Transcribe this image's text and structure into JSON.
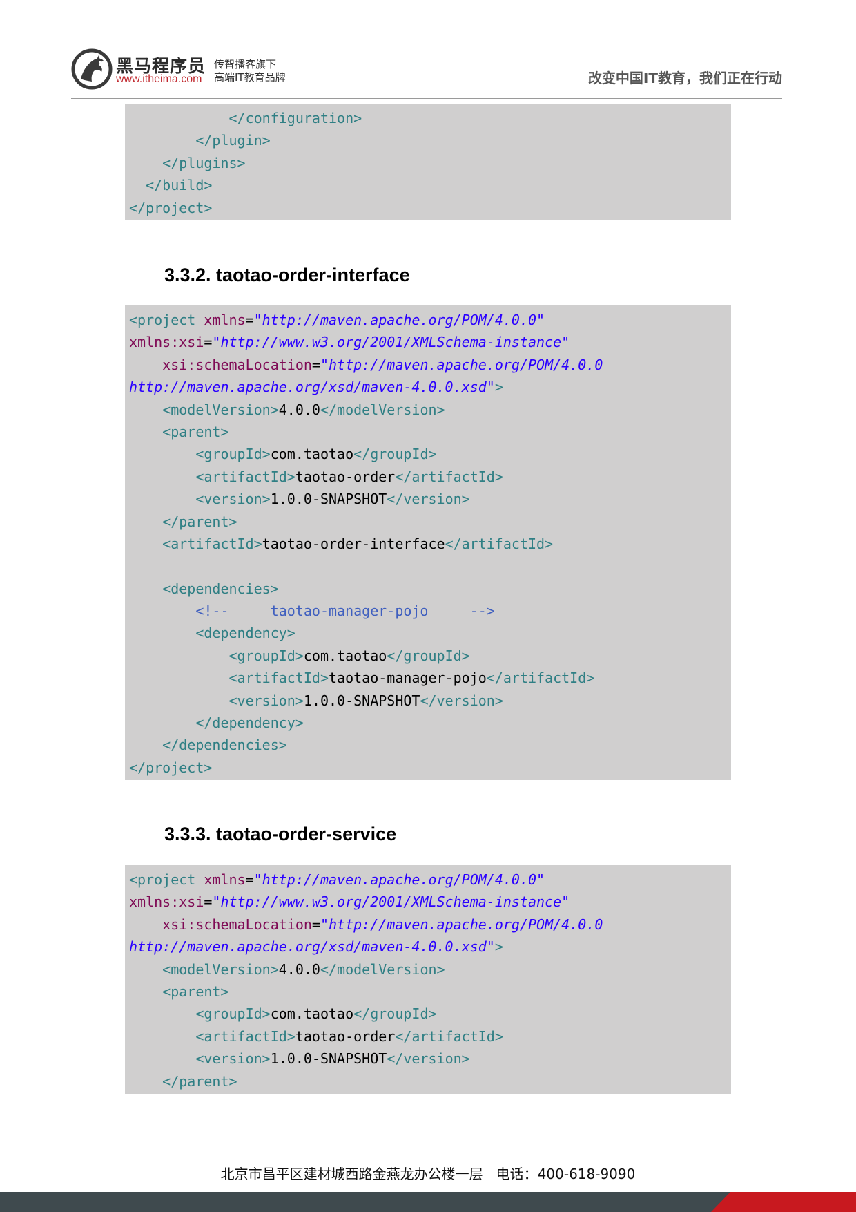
{
  "header": {
    "brand_name": "黑马程序员",
    "brand_url": "www.itheima.com",
    "brand_sub_line1": "传智播客旗下",
    "brand_sub_line2": "高端IT教育品牌",
    "slogan": "改变中国IT教育，我们正在行动",
    "logo_icon": "horse-logo-icon"
  },
  "blocks": [
    {
      "lines": [
        [
          [
            "t",
            "            </configuration>"
          ]
        ],
        [
          [
            "t",
            "        </plugin>"
          ]
        ],
        [
          [
            "t",
            "    </plugins>"
          ]
        ],
        [
          [
            "t",
            "  </build>"
          ]
        ],
        [
          [
            "t",
            "</project>"
          ]
        ]
      ]
    },
    {
      "heading": "3.3.2. taotao-order-interface",
      "lines": [
        [
          [
            "t",
            "<project "
          ],
          [
            "a",
            "xmlns"
          ],
          [
            "tx",
            "="
          ],
          [
            "s",
            "\"http://maven.apache.org/POM/4.0.0\""
          ]
        ],
        [
          [
            "a",
            "xmlns:xsi"
          ],
          [
            "tx",
            "="
          ],
          [
            "s",
            "\"http://www.w3.org/2001/XMLSchema-instance\""
          ]
        ],
        [
          [
            "tx",
            "    "
          ],
          [
            "a",
            "xsi:schemaLocation"
          ],
          [
            "tx",
            "="
          ],
          [
            "s",
            "\"http://maven.apache.org/POM/4.0.0"
          ]
        ],
        [
          [
            "s",
            "http://maven.apache.org/xsd/maven-4.0.0.xsd\""
          ],
          [
            "t",
            ">"
          ]
        ],
        [
          [
            "t",
            "    <modelVersion>"
          ],
          [
            "tx",
            "4.0.0"
          ],
          [
            "t",
            "</modelVersion>"
          ]
        ],
        [
          [
            "t",
            "    <parent>"
          ]
        ],
        [
          [
            "t",
            "        <groupId>"
          ],
          [
            "tx",
            "com.taotao"
          ],
          [
            "t",
            "</groupId>"
          ]
        ],
        [
          [
            "t",
            "        <artifactId>"
          ],
          [
            "tx",
            "taotao-order"
          ],
          [
            "t",
            "</artifactId>"
          ]
        ],
        [
          [
            "t",
            "        <version>"
          ],
          [
            "tx",
            "1.0.0-SNAPSHOT"
          ],
          [
            "t",
            "</version>"
          ]
        ],
        [
          [
            "t",
            "    </parent>"
          ]
        ],
        [
          [
            "t",
            "    <artifactId>"
          ],
          [
            "tx",
            "taotao-order-interface"
          ],
          [
            "t",
            "</artifactId>"
          ]
        ],
        [
          [
            "tx",
            " "
          ]
        ],
        [
          [
            "t",
            "    <dependencies>"
          ]
        ],
        [
          [
            "c",
            "        <!--     taotao-manager-pojo     -->"
          ]
        ],
        [
          [
            "t",
            "        <dependency>"
          ]
        ],
        [
          [
            "t",
            "            <groupId>"
          ],
          [
            "tx",
            "com.taotao"
          ],
          [
            "t",
            "</groupId>"
          ]
        ],
        [
          [
            "t",
            "            <artifactId>"
          ],
          [
            "tx",
            "taotao-manager-pojo"
          ],
          [
            "t",
            "</artifactId>"
          ]
        ],
        [
          [
            "t",
            "            <version>"
          ],
          [
            "tx",
            "1.0.0-SNAPSHOT"
          ],
          [
            "t",
            "</version>"
          ]
        ],
        [
          [
            "t",
            "        </dependency>"
          ]
        ],
        [
          [
            "t",
            "    </dependencies>"
          ]
        ],
        [
          [
            "t",
            "</project>"
          ]
        ]
      ]
    },
    {
      "heading": "3.3.3. taotao-order-service",
      "lines": [
        [
          [
            "t",
            "<project "
          ],
          [
            "a",
            "xmlns"
          ],
          [
            "tx",
            "="
          ],
          [
            "s",
            "\"http://maven.apache.org/POM/4.0.0\""
          ]
        ],
        [
          [
            "a",
            "xmlns:xsi"
          ],
          [
            "tx",
            "="
          ],
          [
            "s",
            "\"http://www.w3.org/2001/XMLSchema-instance\""
          ]
        ],
        [
          [
            "tx",
            "    "
          ],
          [
            "a",
            "xsi:schemaLocation"
          ],
          [
            "tx",
            "="
          ],
          [
            "s",
            "\"http://maven.apache.org/POM/4.0.0"
          ]
        ],
        [
          [
            "s",
            "http://maven.apache.org/xsd/maven-4.0.0.xsd\""
          ],
          [
            "t",
            ">"
          ]
        ],
        [
          [
            "t",
            "    <modelVersion>"
          ],
          [
            "tx",
            "4.0.0"
          ],
          [
            "t",
            "</modelVersion>"
          ]
        ],
        [
          [
            "t",
            "    <parent>"
          ]
        ],
        [
          [
            "t",
            "        <groupId>"
          ],
          [
            "tx",
            "com.taotao"
          ],
          [
            "t",
            "</groupId>"
          ]
        ],
        [
          [
            "t",
            "        <artifactId>"
          ],
          [
            "tx",
            "taotao-order"
          ],
          [
            "t",
            "</artifactId>"
          ]
        ],
        [
          [
            "t",
            "        <version>"
          ],
          [
            "tx",
            "1.0.0-SNAPSHOT"
          ],
          [
            "t",
            "</version>"
          ]
        ],
        [
          [
            "t",
            "    </parent>"
          ]
        ]
      ]
    }
  ],
  "footer": {
    "address": "北京市昌平区建材城西路金燕龙办公楼一层   电话：400-618-9090"
  },
  "colors": {
    "tag": "#2f7f84",
    "attribute": "#7f0a55",
    "value": "#2a00ff",
    "comment": "#3f5fbf",
    "code_background": "#d0cfcf",
    "footer_bar": "#3f4a4e",
    "footer_accent": "#c8191f"
  }
}
